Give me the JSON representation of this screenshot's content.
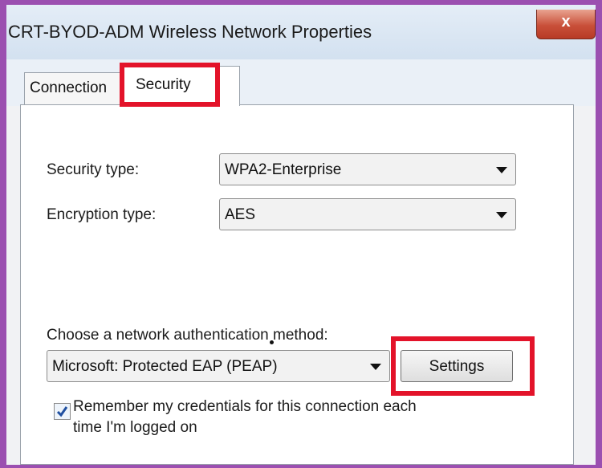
{
  "window": {
    "title": "CRT-BYOD-ADM Wireless Network Properties",
    "close_label": "x"
  },
  "tabs": [
    {
      "label": "Connection",
      "selected": false
    },
    {
      "label": "Security",
      "selected": true
    }
  ],
  "security": {
    "security_type_label": "Security type:",
    "security_type_value": "WPA2-Enterprise",
    "encryption_type_label": "Encryption type:",
    "encryption_type_value": "AES",
    "auth_method_label": "Choose a network authentication method:",
    "auth_method_value": "Microsoft: Protected EAP (PEAP)",
    "settings_label": "Settings",
    "remember_checked": true,
    "remember_line1": "Remember my credentials for this connection each",
    "remember_line2": "time I'm logged on"
  },
  "colors": {
    "highlight": "#e3132a",
    "frame": "#9b4fb0",
    "checkmark": "#1f4fa0"
  },
  "icons": [
    "close-icon",
    "dropdown-arrow-icon",
    "checkmark-icon"
  ]
}
